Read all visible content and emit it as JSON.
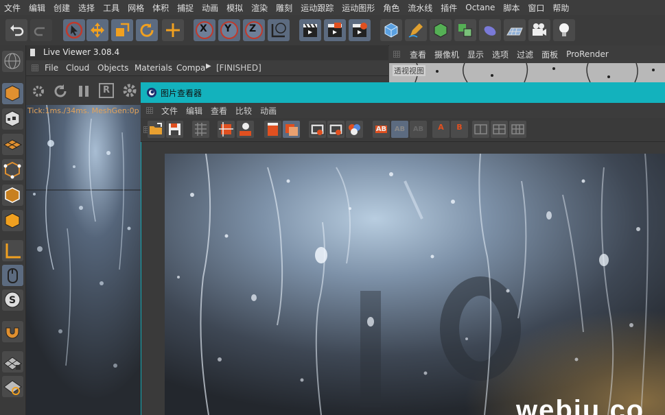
{
  "menubar": {
    "items": [
      "文件",
      "编辑",
      "创建",
      "选择",
      "工具",
      "网格",
      "体积",
      "捕捉",
      "动画",
      "模拟",
      "渲染",
      "雕刻",
      "运动跟踪",
      "运动图形",
      "角色",
      "流水线",
      "插件",
      "Octane",
      "脚本",
      "窗口",
      "帮助"
    ]
  },
  "toolbar": {
    "x_label": "X",
    "y_label": "Y",
    "z_label": "Z"
  },
  "live_viewer": {
    "title": "Live Viewer 3.08.4",
    "menu": [
      "File",
      "Cloud",
      "Objects",
      "Materials",
      "Compa"
    ],
    "status": "[FINISHED]",
    "stats_text": "Tick:1ms./34ms. MeshGen:0p",
    "r_label": "R"
  },
  "viewport": {
    "menu": [
      "查看",
      "摄像机",
      "显示",
      "选项",
      "过滤",
      "面板",
      "ProRender"
    ],
    "label": "透视视图"
  },
  "picture_viewer": {
    "title": "图片查看器",
    "menu": [
      "文件",
      "编辑",
      "查看",
      "比较",
      "动画"
    ],
    "tool_ab_1": "AB",
    "tool_ab_2": "AB",
    "tool_ab_3": "AB",
    "tool_a": "A",
    "tool_b": "B",
    "watermark_text": "webiu.co"
  },
  "colors": {
    "title_bar": "#13b2bd",
    "accent_orange": "#f0a020",
    "accent_blue": "#6a8cc8"
  }
}
